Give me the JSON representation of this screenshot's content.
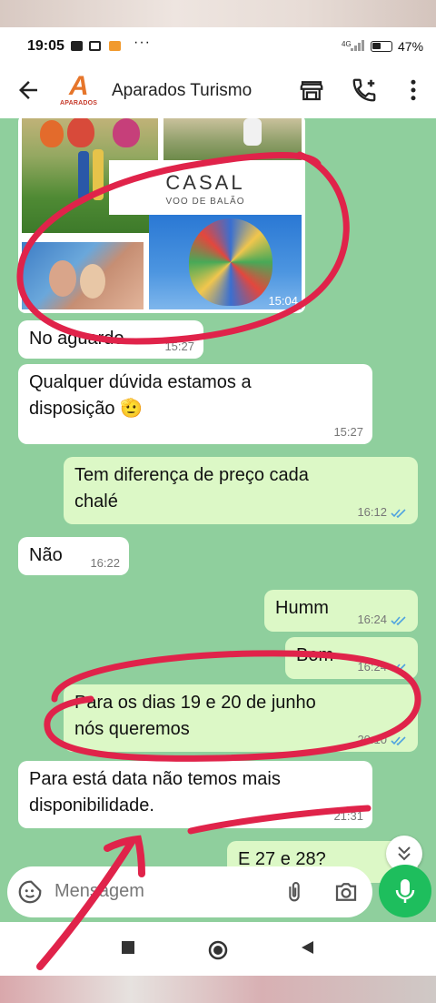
{
  "status_bar": {
    "time": "19:05",
    "more": "···",
    "network": "4G",
    "battery": "47%"
  },
  "header": {
    "logo_text": "APARADOS",
    "contact_name": "Aparados Turismo"
  },
  "media": {
    "title": "CASAL",
    "subtitle": "VOO DE BALÃO",
    "duration": "15:04"
  },
  "messages": [
    {
      "dir": "in",
      "text": "No aguardo",
      "time": "15:27"
    },
    {
      "dir": "in",
      "line1": "Qualquer dúvida estamos a",
      "line2": "disposição 🫡",
      "time": "15:27"
    },
    {
      "dir": "out",
      "line1": "Tem diferença de preço cada",
      "line2": "chalé",
      "time": "16:12"
    },
    {
      "dir": "in",
      "text": "Não",
      "time": "16:22"
    },
    {
      "dir": "out",
      "text": "Humm",
      "time": "16:24"
    },
    {
      "dir": "out",
      "text": "Bom",
      "time": "16:24"
    },
    {
      "dir": "out",
      "line1": "Para os dias 19 e 20 de junho",
      "line2": "nós queremos",
      "time": "20:10"
    },
    {
      "dir": "in",
      "line1": "Para está data não temos mais",
      "line2": "disponibilidade.",
      "time": "21:31"
    },
    {
      "dir": "out",
      "text": "E 27 e 28?"
    }
  ],
  "composer": {
    "placeholder": "Mensagem"
  },
  "colors": {
    "chat_bg": "#8fcf9d",
    "outgoing": "#dcf8c6",
    "incoming": "#ffffff",
    "read_ticks": "#4fa3e0",
    "mic": "#1ebe5d",
    "annotation": "#e0234a"
  }
}
